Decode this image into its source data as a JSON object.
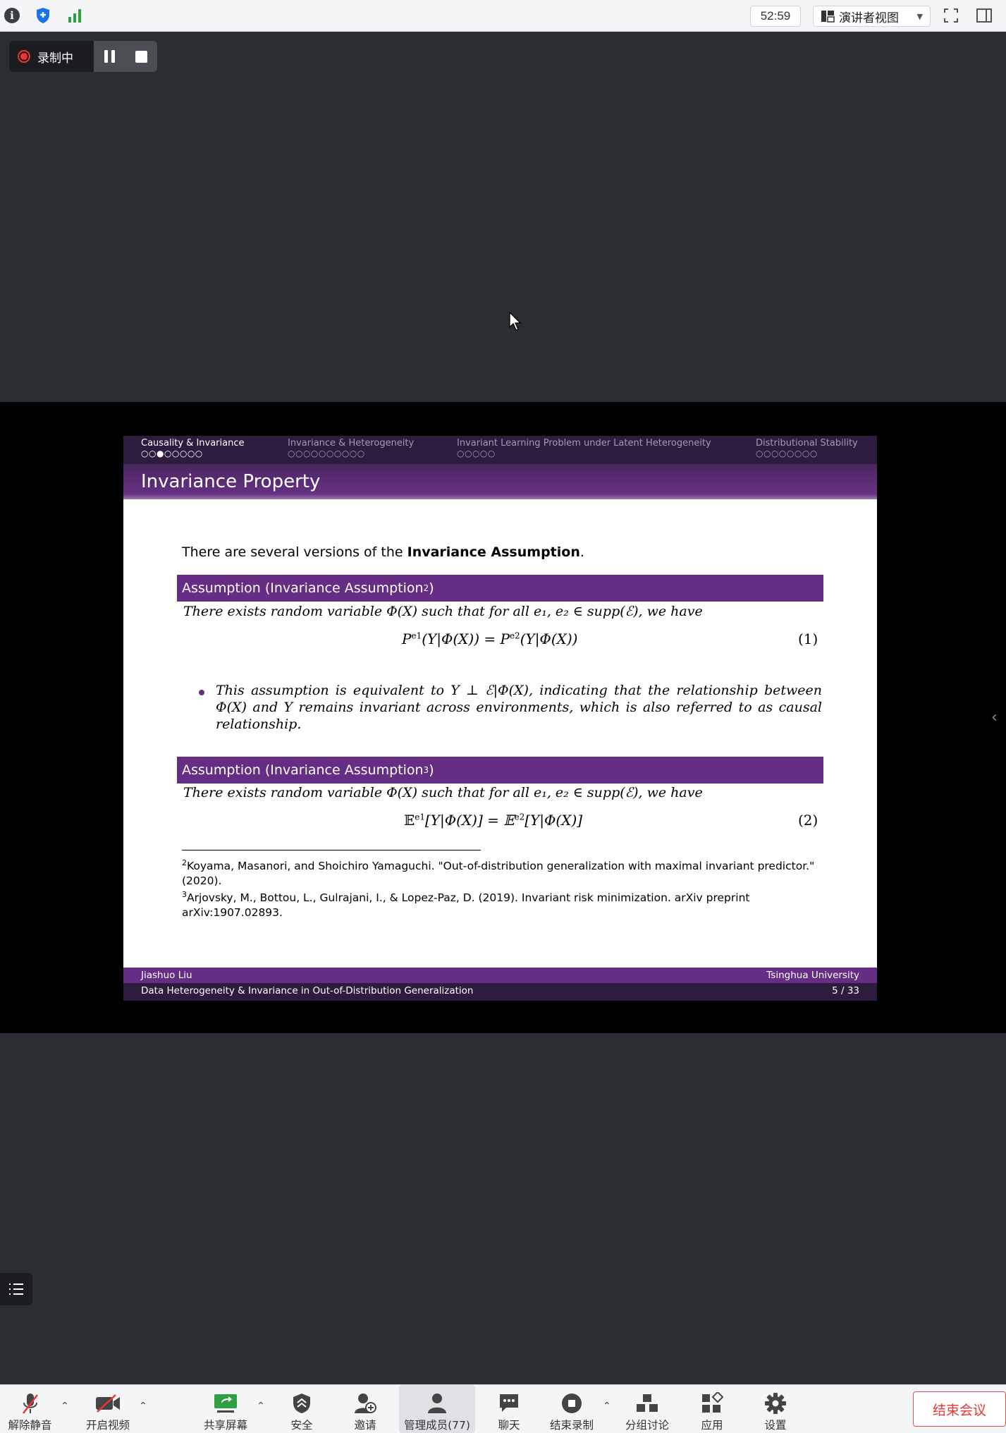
{
  "topbar": {
    "timer": "52:59",
    "view_label": "演讲者视图",
    "icons": [
      "info-icon",
      "shield-icon",
      "signal-icon",
      "fullscreen-icon",
      "sidebar-toggle-icon"
    ],
    "colors": {
      "shield": "#1a73e8",
      "signal": "#2ea043"
    }
  },
  "recording": {
    "status": "录制中",
    "dot_color": "#e33333"
  },
  "slide": {
    "nav": [
      {
        "label": "Causality & Invariance",
        "dots": "○○●○○○○○",
        "active": true
      },
      {
        "label": "Invariance & Heterogeneity",
        "dots": "○○○○○○○○○○",
        "active": false
      },
      {
        "label": "Invariant Learning Problem under Latent Heterogeneity",
        "dots": "○○○○○",
        "active": false
      },
      {
        "label": "Distributional Stability",
        "dots": "○○○○○○○○",
        "active": false
      }
    ],
    "title": "Invariance Property",
    "intro_prefix": "There are several versions of the ",
    "intro_bold": "Invariance Assumption",
    "intro_suffix": ".",
    "block1": {
      "head_prefix": "Assumption (Invariance Assumption",
      "head_sup": "2",
      "head_suffix": ")",
      "text": "There exists random variable Φ(X) such that for all e₁, e₂ ∈ supp(ℰ), we have",
      "eq_lhs": "P",
      "eq_sup1": "e1",
      "eq_mid": "(Y|Φ(X)) = P",
      "eq_sup2": "e2",
      "eq_rhs": "(Y|Φ(X))",
      "eq_num": "(1)"
    },
    "bullet": "This assumption is equivalent to Y ⊥ ℰ|Φ(X), indicating that the relationship between Φ(X) and Y remains invariant across environments, which is also referred to as causal relationship.",
    "block2": {
      "head_prefix": "Assumption (Invariance Assumption ",
      "head_sup": "3",
      "head_suffix": ")",
      "text": "There exists random variable Φ(X) such that for all e₁, e₂ ∈ supp(ℰ), we have",
      "eq_lhs": "𝔼",
      "eq_sup1": "e1",
      "eq_mid": "[Y|Φ(X)] = 𝔼",
      "eq_sup2": "e2",
      "eq_rhs": "[Y|Φ(X)]",
      "eq_num": "(2)"
    },
    "footnotes": [
      {
        "mark": "2",
        "text": "Koyama, Masanori, and Shoichiro Yamaguchi. \"Out-of-distribution generalization with maximal invariant predictor.\" (2020)."
      },
      {
        "mark": "3",
        "text": "Arjovsky, M., Bottou, L., Gulrajani, I., & Lopez-Paz, D. (2019). Invariant risk minimization. arXiv preprint arXiv:1907.02893."
      }
    ],
    "footer": {
      "author": "Jiashuo Liu",
      "institution": "Tsinghua University",
      "talk_title": "Data Heterogeneity & Invariance in Out-of-Distribution Generalization",
      "page": "5 / 33"
    },
    "colors": {
      "purple": "#662d84",
      "dark_purple": "#2e1c3e"
    }
  },
  "toolbar": {
    "items": [
      {
        "label": "解除静音",
        "icon": "mic-muted-icon"
      },
      {
        "label": "开启视频",
        "icon": "video-off-icon"
      },
      {
        "label": "共享屏幕",
        "icon": "share-screen-icon"
      },
      {
        "label": "安全",
        "icon": "security-icon"
      },
      {
        "label": "邀请",
        "icon": "invite-icon"
      },
      {
        "label": "管理成员(77)",
        "icon": "participants-icon"
      },
      {
        "label": "聊天",
        "icon": "chat-icon"
      },
      {
        "label": "结束录制",
        "icon": "stop-record-icon"
      },
      {
        "label": "分组讨论",
        "icon": "breakout-icon"
      },
      {
        "label": "应用",
        "icon": "apps-icon"
      },
      {
        "label": "设置",
        "icon": "settings-icon"
      }
    ],
    "end_label": "结束会议",
    "end_color": "#e33333"
  }
}
